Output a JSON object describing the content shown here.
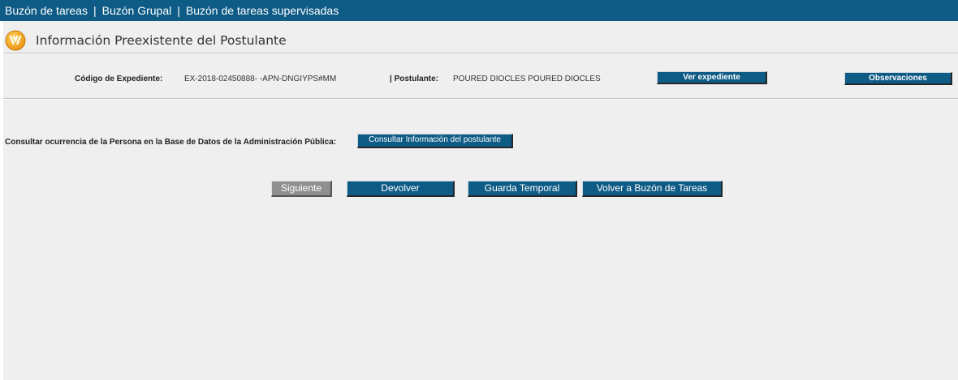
{
  "topnav": {
    "items": [
      "Buzón de tareas",
      "Buzón Grupal",
      "Buzón de tareas supervisadas"
    ],
    "separator": "|"
  },
  "header": {
    "title": "Información Preexistente del Postulante",
    "icon": "tramite-logo-icon"
  },
  "info": {
    "expediente_label": "Código de Expediente:",
    "expediente_value": "EX-2018-02450888- -APN-DNGIYPS#MM",
    "postulante_label": "| Postulante:",
    "postulante_value": "POURED DIOCLES POURED DIOCLES",
    "ver_expediente": "Ver expediente",
    "observaciones": "Observaciones"
  },
  "consulta": {
    "label": "Consultar ocurrencia de la Persona en la Base de Datos de la Administración Pública:",
    "button": "Consultar Información del postulante"
  },
  "actions": {
    "siguiente": "Siguiente",
    "devolver": "Devolver",
    "guarda_temporal": "Guarda Temporal",
    "volver": "Volver a Buzón de Tareas"
  },
  "colors": {
    "primary": "#0e5b86",
    "disabled": "#8f8f8f",
    "background": "#efefef",
    "logo": "#f0a020"
  }
}
